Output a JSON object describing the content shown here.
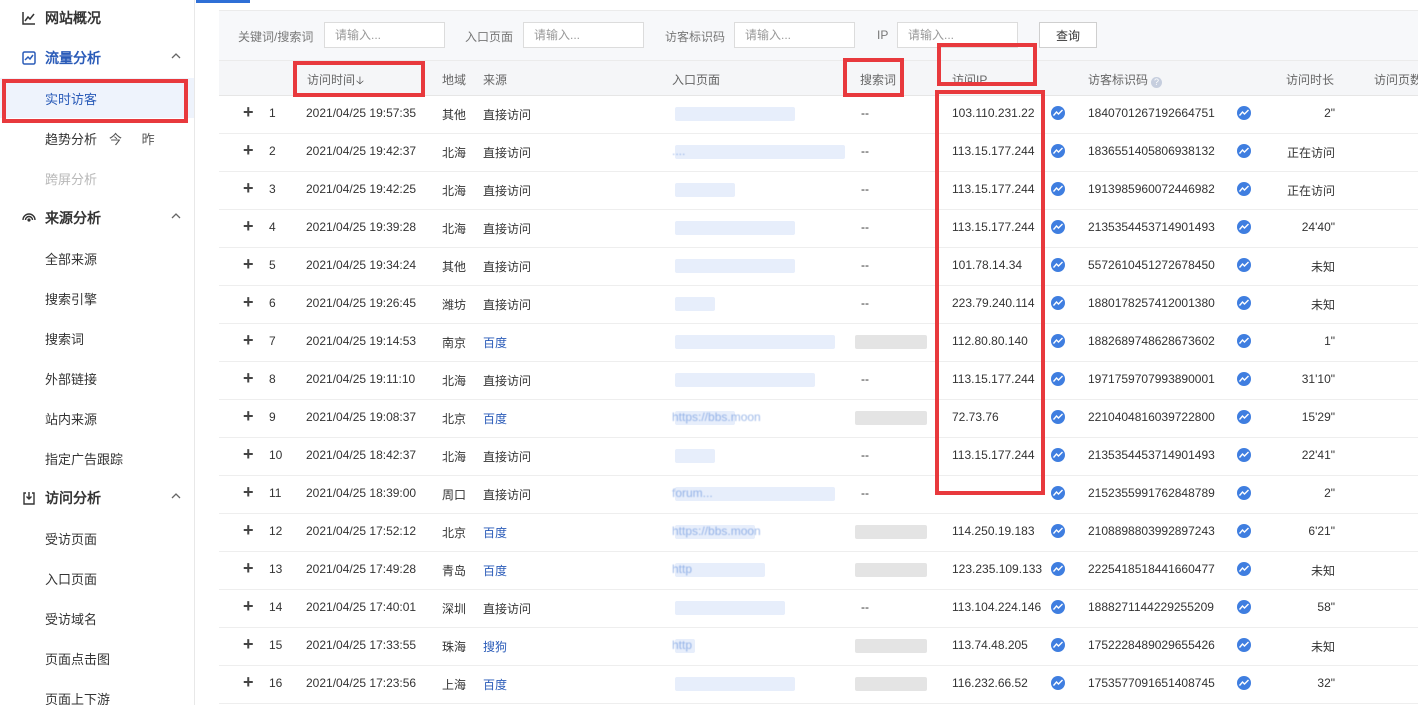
{
  "sidebar": {
    "overview": "网站概况",
    "groups": {
      "traffic": "流量分析",
      "source": "来源分析",
      "visit": "访问分析"
    },
    "items": {
      "realtime": "实时访客",
      "trend": "趋势分析",
      "trend_extra": "今 昨",
      "cross_screen": "跨屏分析",
      "all_sources": "全部来源",
      "search_engine": "搜索引擎",
      "search_terms": "搜索词",
      "external_links": "外部链接",
      "internal_sources": "站内来源",
      "ad_tracking": "指定广告跟踪",
      "visited_pages": "受访页面",
      "entry_pages": "入口页面",
      "visited_domains": "受访域名",
      "page_heatmap": "页面点击图",
      "page_flow": "页面上下游"
    }
  },
  "filters": {
    "keyword_label": "关键词/搜索词",
    "entry_label": "入口页面",
    "visitor_id_label": "访客标识码",
    "ip_label": "IP",
    "placeholder": "请输入...",
    "query_button": "查询"
  },
  "table": {
    "headers": {
      "visit_time": "访问时间",
      "region": "地域",
      "source": "来源",
      "entry_page": "入口页面",
      "search_term": "搜索词",
      "visit_ip": "访问IP",
      "visitor_id": "访客标识码",
      "duration": "访问时长",
      "pages": "访问页数"
    },
    "rows": [
      {
        "no": "1",
        "time": "2021/04/25 19:57:35",
        "region": "其他",
        "source": "直接访问",
        "source_link": false,
        "search": "--",
        "ip": "103.110.231.22",
        "vid": "1840701267192664751",
        "duration": "2\"",
        "entry_text": ""
      },
      {
        "no": "2",
        "time": "2021/04/25 19:42:37",
        "region": "北海",
        "source": "直接访问",
        "source_link": false,
        "search": "--",
        "ip": "113.15.177.244",
        "vid": "1836551405806938132",
        "duration": "正在访问",
        "entry_text": "...."
      },
      {
        "no": "3",
        "time": "2021/04/25 19:42:25",
        "region": "北海",
        "source": "直接访问",
        "source_link": false,
        "search": "--",
        "ip": "113.15.177.244",
        "vid": "1913985960072446982",
        "duration": "正在访问",
        "entry_text": ""
      },
      {
        "no": "4",
        "time": "2021/04/25 19:39:28",
        "region": "北海",
        "source": "直接访问",
        "source_link": false,
        "search": "--",
        "ip": "113.15.177.244",
        "vid": "2135354453714901493",
        "duration": "24'40\"",
        "entry_text": ""
      },
      {
        "no": "5",
        "time": "2021/04/25 19:34:24",
        "region": "其他",
        "source": "直接访问",
        "source_link": false,
        "search": "--",
        "ip": "101.78.14.34",
        "vid": "5572610451272678450",
        "duration": "未知",
        "entry_text": ""
      },
      {
        "no": "6",
        "time": "2021/04/25 19:26:45",
        "region": "潍坊",
        "source": "直接访问",
        "source_link": false,
        "search": "--",
        "ip": "223.79.240.114",
        "vid": "1880178257412001380",
        "duration": "未知",
        "entry_text": ""
      },
      {
        "no": "7",
        "time": "2021/04/25 19:14:53",
        "region": "南京",
        "source": "百度",
        "source_link": true,
        "search": "",
        "ip": "112.80.80.140",
        "vid": "1882689748628673602",
        "duration": "1\"",
        "entry_text": ""
      },
      {
        "no": "8",
        "time": "2021/04/25 19:11:10",
        "region": "北海",
        "source": "直接访问",
        "source_link": false,
        "search": "--",
        "ip": "113.15.177.244",
        "vid": "1971759707993890001",
        "duration": "31'10\"",
        "entry_text": ""
      },
      {
        "no": "9",
        "time": "2021/04/25 19:08:37",
        "region": "北京",
        "source": "百度",
        "source_link": true,
        "search": "",
        "ip": "72.73.76",
        "vid": "2210404816039722800",
        "duration": "15'29\"",
        "entry_text": "https://bbs.moon"
      },
      {
        "no": "10",
        "time": "2021/04/25 18:42:37",
        "region": "北海",
        "source": "直接访问",
        "source_link": false,
        "search": "--",
        "ip": "113.15.177.244",
        "vid": "2135354453714901493",
        "duration": "22'41\"",
        "entry_text": ""
      },
      {
        "no": "11",
        "time": "2021/04/25 18:39:00",
        "region": "周口",
        "source": "直接访问",
        "source_link": false,
        "search": "--",
        "ip": "",
        "vid": "2152355991762848789",
        "duration": "2\"",
        "entry_text": "forum..."
      },
      {
        "no": "12",
        "time": "2021/04/25 17:52:12",
        "region": "北京",
        "source": "百度",
        "source_link": true,
        "search": "",
        "ip": "114.250.19.183",
        "vid": "2108898803992897243",
        "duration": "6'21\"",
        "entry_text": "https://bbs.moon"
      },
      {
        "no": "13",
        "time": "2021/04/25 17:49:28",
        "region": "青岛",
        "source": "百度",
        "source_link": true,
        "search": "",
        "ip": "123.235.109.133",
        "vid": "2225418518441660477",
        "duration": "未知",
        "entry_text": "http"
      },
      {
        "no": "14",
        "time": "2021/04/25 17:40:01",
        "region": "深圳",
        "source": "直接访问",
        "source_link": false,
        "search": "--",
        "ip": "113.104.224.146",
        "vid": "1888271144229255209",
        "duration": "58\"",
        "entry_text": ""
      },
      {
        "no": "15",
        "time": "2021/04/25 17:33:55",
        "region": "珠海",
        "source": "搜狗",
        "source_link": true,
        "search": "",
        "ip": "113.74.48.205",
        "vid": "1752228489029655426",
        "duration": "未知",
        "entry_text": "http"
      },
      {
        "no": "16",
        "time": "2021/04/25 17:23:56",
        "region": "上海",
        "source": "百度",
        "source_link": true,
        "search": "",
        "ip": "116.232.66.52",
        "vid": "1753577091651408745",
        "duration": "32\"",
        "entry_text": ""
      }
    ]
  },
  "colors": {
    "accent": "#2f6fd6",
    "link": "#2a5bb8",
    "highlight": "#e8393d"
  }
}
